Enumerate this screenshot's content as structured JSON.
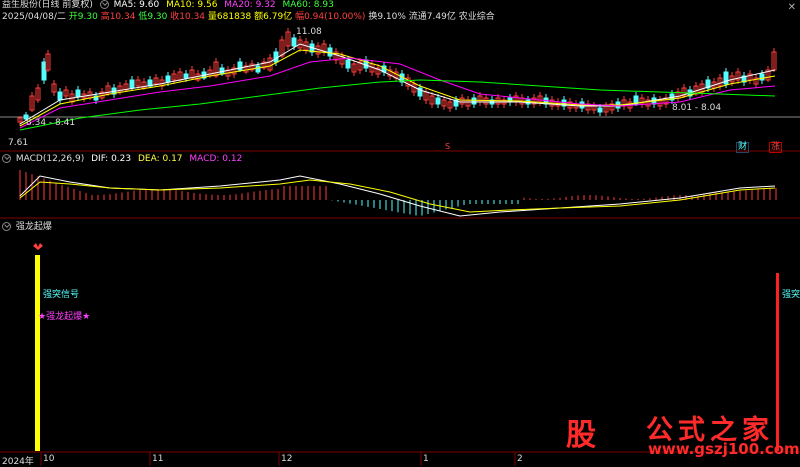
{
  "header": {
    "title": "益生股份(日线 前复权)",
    "ma5": "MA5: 9.60",
    "ma10": "MA10: 9.56",
    "ma20": "MA20: 9.32",
    "ma60": "MA60: 8.93"
  },
  "info": {
    "date": "2025/04/08/二",
    "open": "开9.30",
    "high": "高10.34",
    "low": "低9.30",
    "close": "收10.34",
    "volume": "量681838",
    "amount": "额6.79亿",
    "change": "幅0.94(10.00%)",
    "turnover": "换9.10%",
    "float_cap": "流通7.49亿",
    "industry": "农业综合"
  },
  "price_labels": {
    "peak": "11.08",
    "left_range": "8.34 - 8.41",
    "low": "7.61",
    "right_range": "8.01 - 8.04"
  },
  "markers": {
    "m1": "S",
    "cai": "财",
    "zhang": "涨"
  },
  "macd": {
    "label": "MACD(12,26,9)",
    "dif": "DIF: 0.23",
    "dea": "DEA: 0.17",
    "macd": "MACD: 0.12"
  },
  "indicator": {
    "name": "强龙起爆",
    "signal1": "强突信号",
    "signal2": "强龙起爆",
    "signal_right": "强突"
  },
  "time_axis": {
    "year": "2024年",
    "ticks": [
      "10",
      "11",
      "12",
      "1",
      "2"
    ]
  },
  "watermark": {
    "logo": "股",
    "text": "公式之家",
    "url": "www.gszj100.com"
  },
  "colors": {
    "up": "#ff3c3c",
    "down": "#54ffff",
    "ma5": "#ffffff",
    "ma10": "#ffff00",
    "ma20": "#ff00ff",
    "ma60": "#00ff00",
    "signal_bar_left": "#ffff00",
    "signal_bar_right": "#ff2020"
  }
}
